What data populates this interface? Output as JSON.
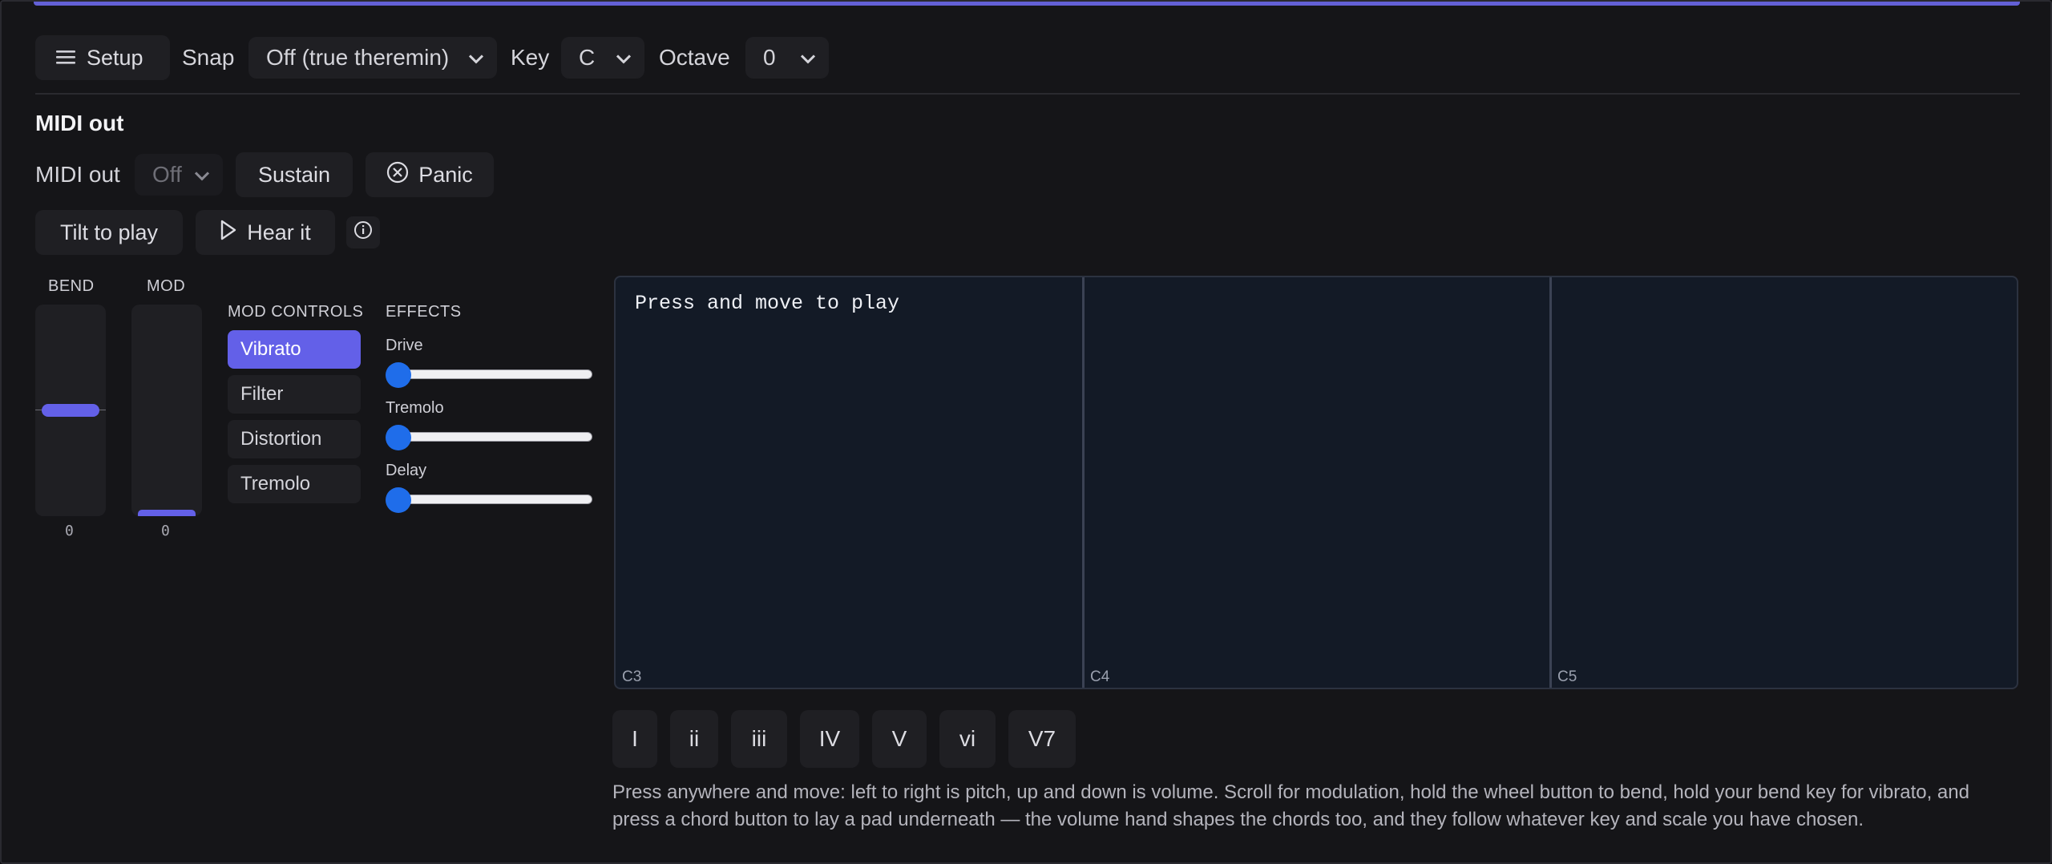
{
  "toolbar": {
    "setup_label": "Setup",
    "snap_label": "Snap",
    "snap_value": "Off (true theremin)",
    "key_label": "Key",
    "key_value": "C",
    "octave_label": "Octave",
    "octave_value": "0"
  },
  "midi": {
    "heading": "MIDI out",
    "out_label": "MIDI out",
    "out_value": "Off",
    "sustain_label": "Sustain",
    "panic_label": "Panic",
    "tilt_label": "Tilt to play",
    "hear_label": "Hear it"
  },
  "wheels": {
    "bend_label": "BEND",
    "bend_value": "0",
    "mod_label": "MOD",
    "mod_value": "0"
  },
  "mod_controls": {
    "title": "MOD CONTROLS",
    "items": [
      {
        "label": "Vibrato",
        "active": true
      },
      {
        "label": "Filter",
        "active": false
      },
      {
        "label": "Distortion",
        "active": false
      },
      {
        "label": "Tremolo",
        "active": false
      }
    ]
  },
  "effects": {
    "title": "EFFECTS",
    "sliders": [
      {
        "label": "Drive",
        "value": 0
      },
      {
        "label": "Tremolo",
        "value": 0
      },
      {
        "label": "Delay",
        "value": 0
      }
    ]
  },
  "pad": {
    "prompt": "Press and move to play",
    "notes": [
      "C3",
      "C4",
      "C5"
    ]
  },
  "chords": [
    "I",
    "ii",
    "iii",
    "IV",
    "V",
    "vi",
    "V7"
  ],
  "help_text": "Press anywhere and move: left to right is pitch, up and down is volume. Scroll for modulation, hold the wheel button to bend, hold your bend key for vibrato, and press a chord button to lay a pad underneath — the volume hand shapes the chords too, and they follow whatever key and scale you have chosen.",
  "colors": {
    "accent": "#6360e8",
    "slider_thumb": "#1f6dea",
    "pad_bg": "#131a26"
  },
  "icons": [
    "menu-icon",
    "chevron-down-icon",
    "circle-x-icon",
    "play-icon",
    "info-icon"
  ]
}
